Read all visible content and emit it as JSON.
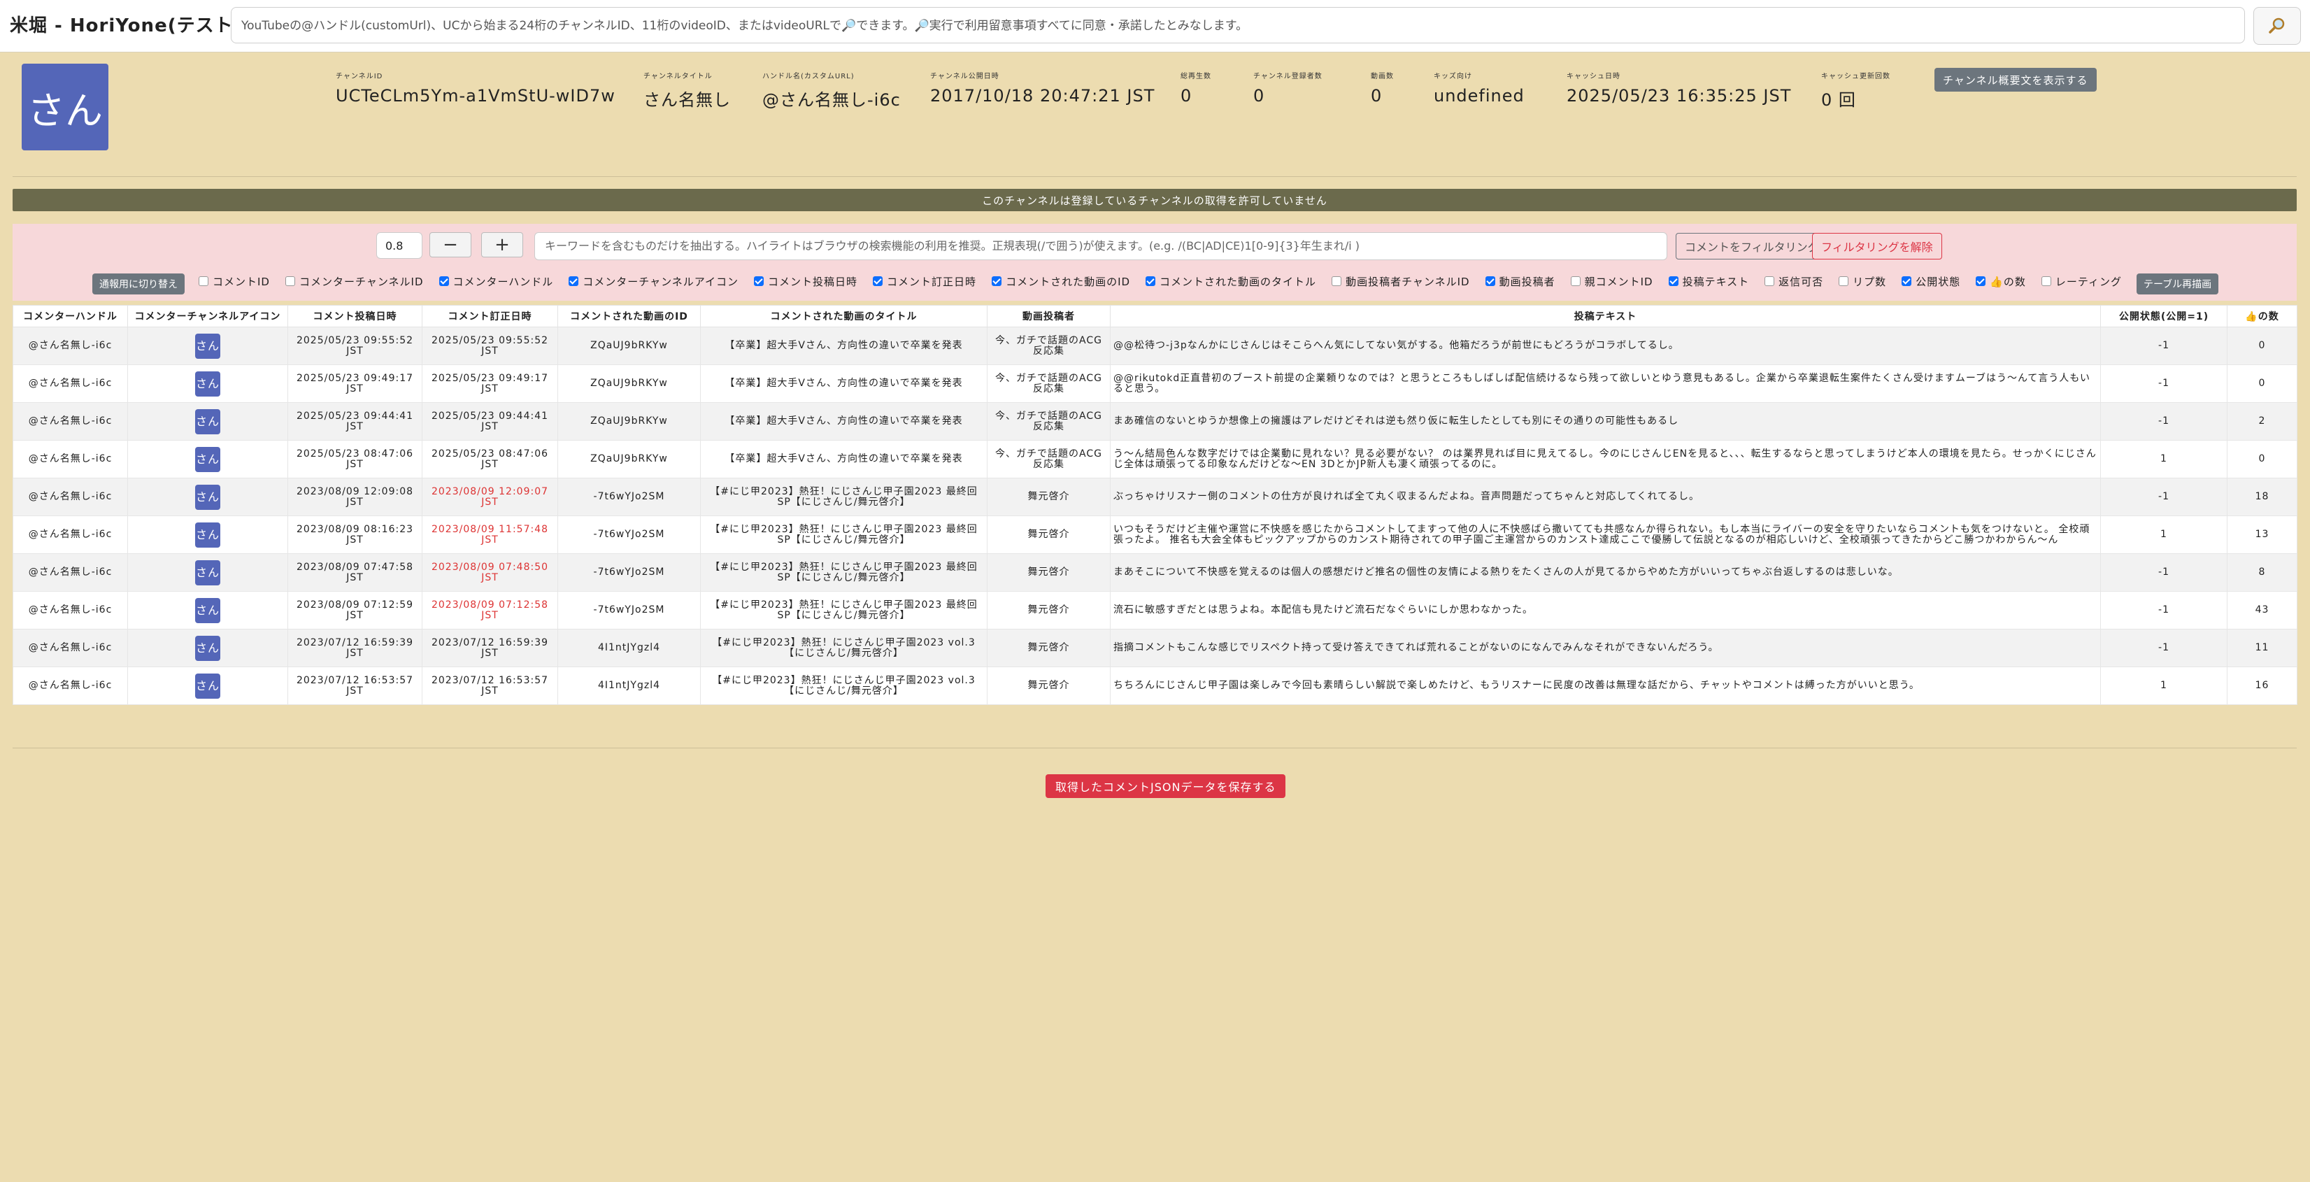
{
  "app": {
    "title": "米堀 - HoriYone(テスト中)"
  },
  "search": {
    "placeholder": "YouTubeの@ハンドル(customUrl)、UCから始まる24桁のチャンネルID、11桁のvideoID、またはvideoURLで🔎できます。🔎実行で利用留意事項すべてに同意・承諾したとみなします。",
    "button_icon": "🔎"
  },
  "channel": {
    "avatar_text": "さん",
    "fields": [
      {
        "label": "チャンネルID",
        "value": "UCTeCLm5Ym-a1VmStU-wID7w"
      },
      {
        "label": "チャンネルタイトル",
        "value": "さん名無し"
      },
      {
        "label": "ハンドル名(カスタムURL)",
        "value": "@さん名無し-i6c"
      },
      {
        "label": "チャンネル公開日時",
        "value": "2017/10/18 20:47:21 JST"
      },
      {
        "label": "総再生数",
        "value": "0"
      },
      {
        "label": "チャンネル登録者数",
        "value": "0"
      },
      {
        "label": "動画数",
        "value": "0"
      },
      {
        "label": "キッズ向け",
        "value": "undefined"
      },
      {
        "label": "キャッシュ日時",
        "value": "2025/05/23 16:35:25 JST"
      },
      {
        "label": "キャッシュ更新回数",
        "value": "0 回"
      }
    ],
    "summary_button": "チャンネル概要文を表示する"
  },
  "notice": "このチャンネルは登録しているチャンネルの取得を許可していません",
  "filter": {
    "zoom_value": "0.8",
    "zoom_minus": "−",
    "zoom_plus": "+",
    "keyword_placeholder": "キーワードを含むものだけを抽出する。ハイライトはブラウザの検索機能の利用を推奨。正規表現(/で囲う)が使えます。(e.g. /(BC|AD|CE)1[0-9]{3}年生まれ/i )",
    "filter_button": "コメントをフィルタリング",
    "clear_button": "フィルタリングを解除",
    "mode_button": "通報用に切り替え",
    "redraw_button": "テーブル再描画",
    "columns": [
      {
        "label": "コメントID",
        "checked": false
      },
      {
        "label": "コメンターチャンネルID",
        "checked": false
      },
      {
        "label": "コメンターハンドル",
        "checked": true
      },
      {
        "label": "コメンターチャンネルアイコン",
        "checked": true
      },
      {
        "label": "コメント投稿日時",
        "checked": true
      },
      {
        "label": "コメント訂正日時",
        "checked": true
      },
      {
        "label": "コメントされた動画のID",
        "checked": true
      },
      {
        "label": "コメントされた動画のタイトル",
        "checked": true
      },
      {
        "label": "動画投稿者チャンネルID",
        "checked": false
      },
      {
        "label": "動画投稿者",
        "checked": true
      },
      {
        "label": "親コメントID",
        "checked": false
      },
      {
        "label": "投稿テキスト",
        "checked": true
      },
      {
        "label": "返信可否",
        "checked": false
      },
      {
        "label": "リプ数",
        "checked": false
      },
      {
        "label": "公開状態",
        "checked": true
      },
      {
        "label": "👍の数",
        "checked": true
      },
      {
        "label": "レーティング",
        "checked": false
      }
    ]
  },
  "table": {
    "headers": [
      "コメンターハンドル",
      "コメンターチャンネルアイコン",
      "コメント投稿日時",
      "コメント訂正日時",
      "コメントされた動画のID",
      "コメントされた動画のタイトル",
      "動画投稿者",
      "投稿テキスト",
      "公開状態(公開=1)",
      "👍の数"
    ],
    "rows": [
      {
        "handle": "@さん名無し-i6c",
        "icon": "さん",
        "posted": "2025/05/23 09:55:52 JST",
        "edited": "2025/05/23 09:55:52 JST",
        "edited_red": false,
        "video_id": "ZQaUJ9bRKYw",
        "video_title": "【卒業】超大手Vさん、方向性の違いで卒業を発表",
        "uploader": "今、ガチで話題のACG反応集",
        "text": "@@松待つ-j3pなんかにじさんじはそこらへん気にしてない気がする。他箱だろうが前世にもどろうがコラボしてるし。",
        "status": "-1",
        "likes": "0"
      },
      {
        "handle": "@さん名無し-i6c",
        "icon": "さん",
        "posted": "2025/05/23 09:49:17 JST",
        "edited": "2025/05/23 09:49:17 JST",
        "edited_red": false,
        "video_id": "ZQaUJ9bRKYw",
        "video_title": "【卒業】超大手Vさん、方向性の違いで卒業を発表",
        "uploader": "今、ガチで話題のACG反応集",
        "text": "@@rikutokd正直昔初のブースト前提の企業頼りなのでは？と思うところもしばしば配信続けるなら残って欲しいとゆう意見もあるし。企業から卒業退転生案件たくさん受けますムーブはう〜んて言う人もいると思う。",
        "status": "-1",
        "likes": "0"
      },
      {
        "handle": "@さん名無し-i6c",
        "icon": "さん",
        "posted": "2025/05/23 09:44:41 JST",
        "edited": "2025/05/23 09:44:41 JST",
        "edited_red": false,
        "video_id": "ZQaUJ9bRKYw",
        "video_title": "【卒業】超大手Vさん、方向性の違いで卒業を発表",
        "uploader": "今、ガチで話題のACG反応集",
        "text": "まあ確信のないとゆうか想像上の擁護はアレだけどそれは逆も然り仮に転生したとしても別にその通りの可能性もあるし",
        "status": "-1",
        "likes": "2"
      },
      {
        "handle": "@さん名無し-i6c",
        "icon": "さん",
        "posted": "2025/05/23 08:47:06 JST",
        "edited": "2025/05/23 08:47:06 JST",
        "edited_red": false,
        "video_id": "ZQaUJ9bRKYw",
        "video_title": "【卒業】超大手Vさん、方向性の違いで卒業を発表",
        "uploader": "今、ガチで話題のACG反応集",
        "text": "う〜ん結局色んな数字だけでは企業動に見れない？見る必要がない？ のは業界見れば目に見えてるし。今のにじさんじENを見ると、、、転生するならと思ってしまうけど本人の環境を見たら。せっかくにじさんじ全体は頑張ってる印象なんだけどな〜EN 3DとかJP新人も凄く頑張ってるのに。",
        "status": "1",
        "likes": "0"
      },
      {
        "handle": "@さん名無し-i6c",
        "icon": "さん",
        "posted": "2023/08/09 12:09:08 JST",
        "edited": "2023/08/09 12:09:07 JST",
        "edited_red": true,
        "video_id": "-7t6wYJo2SM",
        "video_title": "【#にじ甲2023】熱狂！にじさんじ甲子園2023 最終回SP【にじさんじ/舞元啓介】",
        "uploader": "舞元啓介",
        "text": "ぶっちゃけリスナー側のコメントの仕方が良ければ全て丸く収まるんだよね。音声問題だってちゃんと対応してくれてるし。",
        "status": "-1",
        "likes": "18"
      },
      {
        "handle": "@さん名無し-i6c",
        "icon": "さん",
        "posted": "2023/08/09 08:16:23 JST",
        "edited": "2023/08/09 11:57:48 JST",
        "edited_red": true,
        "video_id": "-7t6wYJo2SM",
        "video_title": "【#にじ甲2023】熱狂！にじさんじ甲子園2023 最終回SP【にじさんじ/舞元啓介】",
        "uploader": "舞元啓介",
        "text": "いつもそうだけど主催や運営に不快感を感じたからコメントしてますって他の人に不快感ばら撒いてても共感なんか得られない。もし本当にライバーの安全を守りたいならコメントも気をつけないと。 全校頑張ったよ。 推名も大会全体もピックアップからのカンスト期待されての甲子園ご主運営からのカンスト達成ここで優勝して伝説となるのが相応しいけど、全校頑張ってきたからどこ勝つかわからん〜ん",
        "status": "1",
        "likes": "13"
      },
      {
        "handle": "@さん名無し-i6c",
        "icon": "さん",
        "posted": "2023/08/09 07:47:58 JST",
        "edited": "2023/08/09 07:48:50 JST",
        "edited_red": true,
        "video_id": "-7t6wYJo2SM",
        "video_title": "【#にじ甲2023】熱狂！にじさんじ甲子園2023 最終回SP【にじさんじ/舞元啓介】",
        "uploader": "舞元啓介",
        "text": "まあそこについて不快感を覚えるのは個人の感想だけど推名の個性の友情による熱りをたくさんの人が見てるからやめた方がいいってちゃぶ台返しするのは悲しいな。",
        "status": "-1",
        "likes": "8"
      },
      {
        "handle": "@さん名無し-i6c",
        "icon": "さん",
        "posted": "2023/08/09 07:12:59 JST",
        "edited": "2023/08/09 07:12:58 JST",
        "edited_red": true,
        "video_id": "-7t6wYJo2SM",
        "video_title": "【#にじ甲2023】熱狂！にじさんじ甲子園2023 最終回SP【にじさんじ/舞元啓介】",
        "uploader": "舞元啓介",
        "text": "流石に敏感すぎだとは思うよね。本配信も見たけど流石だなぐらいにしか思わなかった。",
        "status": "-1",
        "likes": "43"
      },
      {
        "handle": "@さん名無し-i6c",
        "icon": "さん",
        "posted": "2023/07/12 16:59:39 JST",
        "edited": "2023/07/12 16:59:39 JST",
        "edited_red": false,
        "video_id": "4I1ntJYgzl4",
        "video_title": "【#にじ甲2023】熱狂！にじさんじ甲子園2023 vol.3【にじさんじ/舞元啓介】",
        "uploader": "舞元啓介",
        "text": "指摘コメントもこんな感じでリスペクト持って受け答えできてれば荒れることがないのになんでみんなそれができないんだろう。",
        "status": "-1",
        "likes": "11"
      },
      {
        "handle": "@さん名無し-i6c",
        "icon": "さん",
        "posted": "2023/07/12 16:53:57 JST",
        "edited": "2023/07/12 16:53:57 JST",
        "edited_red": false,
        "video_id": "4I1ntJYgzl4",
        "video_title": "【#にじ甲2023】熱狂！にじさんじ甲子園2023 vol.3【にじさんじ/舞元啓介】",
        "uploader": "舞元啓介",
        "text": "ちちろんにじさんじ甲子園は楽しみで今回も素晴らしい解説で楽しめたけど、もうリスナーに民度の改善は無理な話だから、チャットやコメントは縛った方がいいと思う。",
        "status": "1",
        "likes": "16"
      }
    ]
  },
  "save_button": "取得したコメントJSONデータを保存する"
}
